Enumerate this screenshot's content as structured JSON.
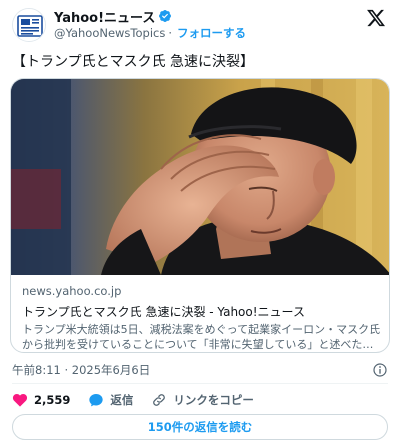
{
  "account": {
    "name": "Yahoo!ニュース",
    "handle": "@YahooNewsTopics",
    "separator": "·",
    "follow_label": "フォローする"
  },
  "tweet": {
    "text": "【トランプ氏とマスク氏 急速に決裂】"
  },
  "link_card": {
    "domain": "news.yahoo.co.jp",
    "title": "トランプ氏とマスク氏 急速に決裂 - Yahoo!ニュース",
    "description_line1": "トランプ米大統領は5日、減税法案をめぐって起業家イーロン・マスク氏",
    "description_line2": "から批判を受けていることについて「非常に失望している」と述べた…"
  },
  "timestamp": "午前8:11 · 2025年6月6日",
  "actions": {
    "like_count": "2,559",
    "reply_label": "返信",
    "copy_link_label": "リンクをコピー"
  },
  "read_replies_label": "150件の返信を読む",
  "colors": {
    "accent": "#1d9bf0",
    "like": "#f91880",
    "text": "#0f1419",
    "muted": "#536471",
    "border": "#cfd9de"
  },
  "icons": [
    "yahoo-news-logo-icon",
    "verified-badge-icon",
    "x-logo-icon",
    "info-icon",
    "heart-icon",
    "reply-icon",
    "link-icon"
  ]
}
